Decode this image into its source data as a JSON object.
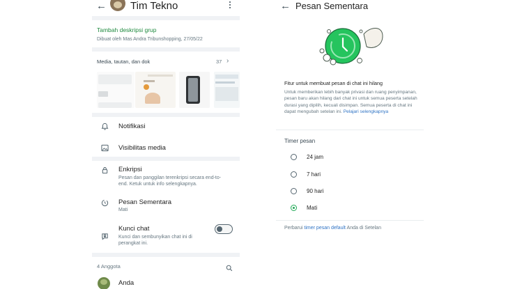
{
  "left": {
    "header": {
      "title": "Tim Tekno"
    },
    "group": {
      "add_description": "Tambah deskripsi grup",
      "created_by": "Dibuat oleh Mas Andra Tribunshopping, 27/05/22"
    },
    "media": {
      "label": "Media, tautan, dan dok",
      "count": "37"
    },
    "rows": {
      "notifications": {
        "label": "Notifikasi"
      },
      "media_visibility": {
        "label": "Visibilitas media"
      },
      "encryption": {
        "label": "Enkripsi",
        "sub": "Pesan dan panggilan terenkripsi secara end-to-end. Ketuk untuk info selengkapnya."
      },
      "disappearing": {
        "label": "Pesan Sementara",
        "sub": "Mati"
      },
      "chat_lock": {
        "label": "Kunci chat",
        "sub": "Kunci dan sembunyikan chat ini di perangkat ini.",
        "enabled": false
      }
    },
    "members": {
      "label": "4 Anggota",
      "first": "Anda"
    }
  },
  "right": {
    "header": {
      "title": "Pesan Sementara"
    },
    "intro": {
      "heading": "Fitur untuk membuat pesan di chat ini hilang",
      "body": "Untuk memberikan lebih banyak privasi dan ruang penyimpanan, pesan baru akan hilang dari chat ini untuk semua peserta setelah durasi yang dipilih, kecuali disimpan. Semua peserta di chat ini dapat mengubah setelan ini.",
      "link": "Pelajari selengkapnya"
    },
    "timer": {
      "label": "Timer pesan",
      "options": [
        "24 jam",
        "7 hari",
        "90 hari",
        "Mati"
      ],
      "selected": "Mati"
    },
    "footer": {
      "pre": "Perbarui",
      "link": "timer pesan default",
      "post": "Anda di Setelan"
    }
  },
  "colors": {
    "accent": "#1fa855",
    "link": "#2f73c4",
    "text_secondary": "#667781"
  }
}
